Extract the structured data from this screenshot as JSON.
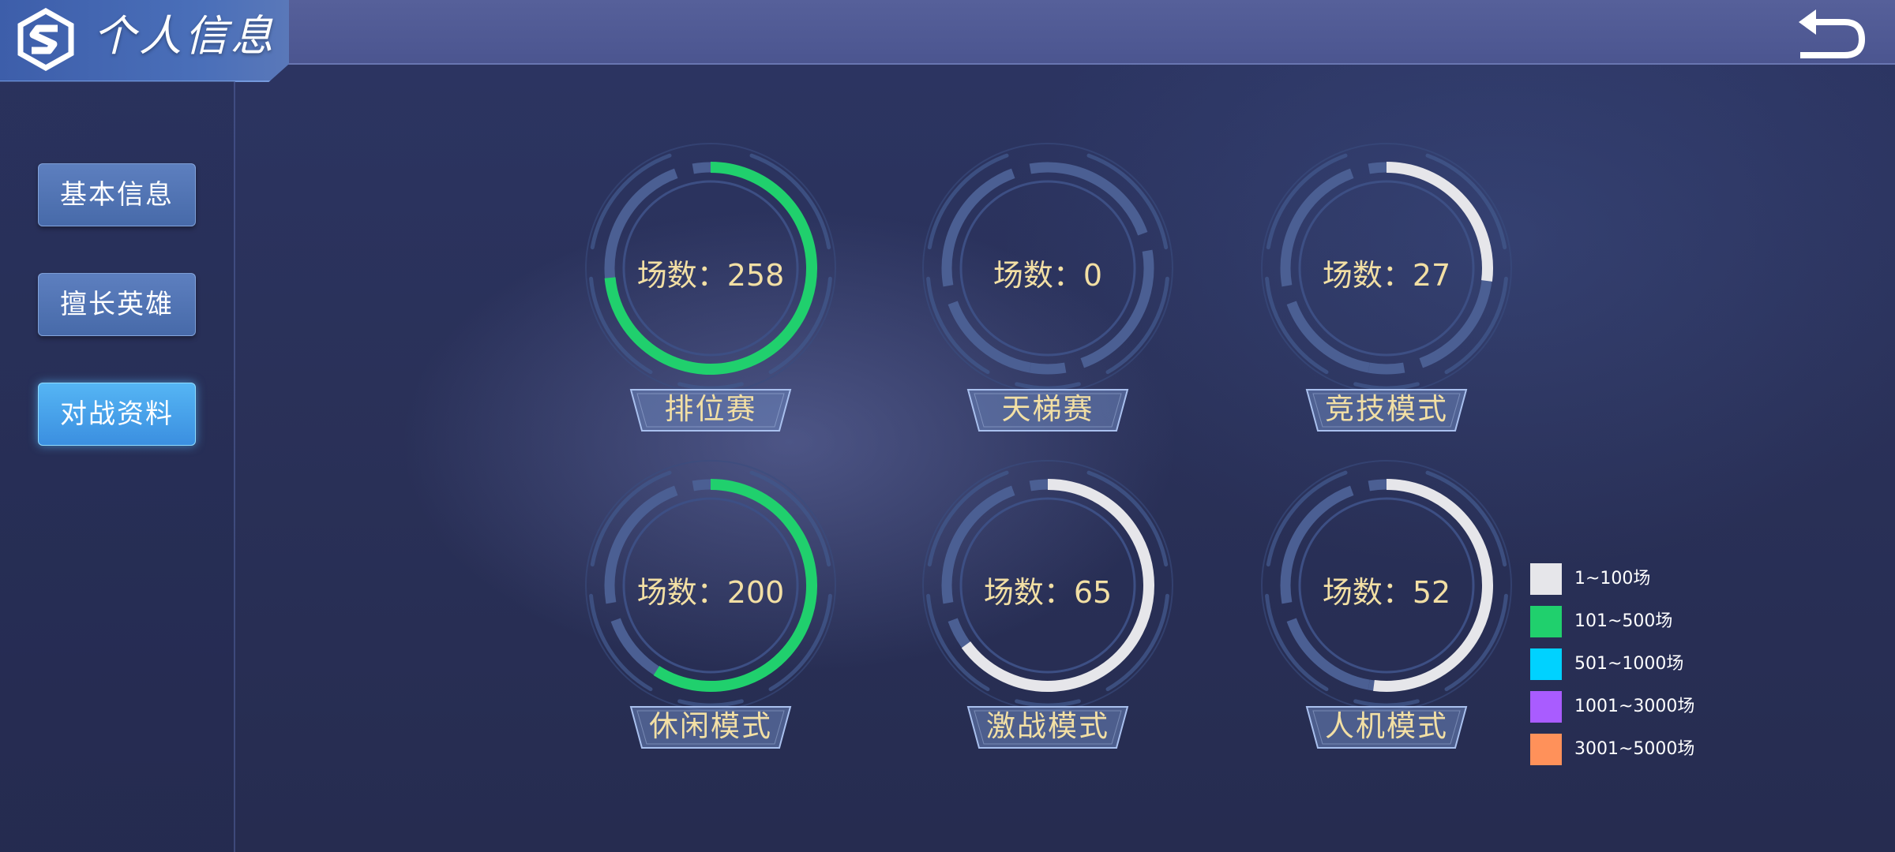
{
  "header": {
    "title": "个人信息",
    "logo_icon": "s-logo-icon",
    "back_icon": "back-arrow-icon"
  },
  "sidebar": {
    "items": [
      {
        "label": "基本信息",
        "active": false
      },
      {
        "label": "擅长英雄",
        "active": false
      },
      {
        "label": "对战资料",
        "active": true
      }
    ]
  },
  "stats": [
    {
      "mode": "排位赛",
      "count_text": "场数：258",
      "matches": 258,
      "ring_color": "#20d06d"
    },
    {
      "mode": "天梯赛",
      "count_text": "场数：0",
      "matches": 0,
      "ring_color": "#e6e6ea"
    },
    {
      "mode": "竞技模式",
      "count_text": "场数：27",
      "matches": 27,
      "ring_color": "#e6e6ea"
    },
    {
      "mode": "休闲模式",
      "count_text": "场数：200",
      "matches": 200,
      "ring_color": "#20d06d"
    },
    {
      "mode": "激战模式",
      "count_text": "场数：65",
      "matches": 65,
      "ring_color": "#e6e6ea"
    },
    {
      "mode": "人机模式",
      "count_text": "场数：52",
      "matches": 52,
      "ring_color": "#e6e6ea"
    }
  ],
  "legend": [
    {
      "label": "1~100场",
      "color": "#e6e6ea"
    },
    {
      "label": "101~500场",
      "color": "#20d06d"
    },
    {
      "label": "501~1000场",
      "color": "#00d2ff"
    },
    {
      "label": "1001~3000场",
      "color": "#a95cff"
    },
    {
      "label": "3001~5000场",
      "color": "#ff915a"
    }
  ],
  "theme": {
    "accent_gold": "#f2dfa4",
    "ring_track": "#4b5f93"
  }
}
